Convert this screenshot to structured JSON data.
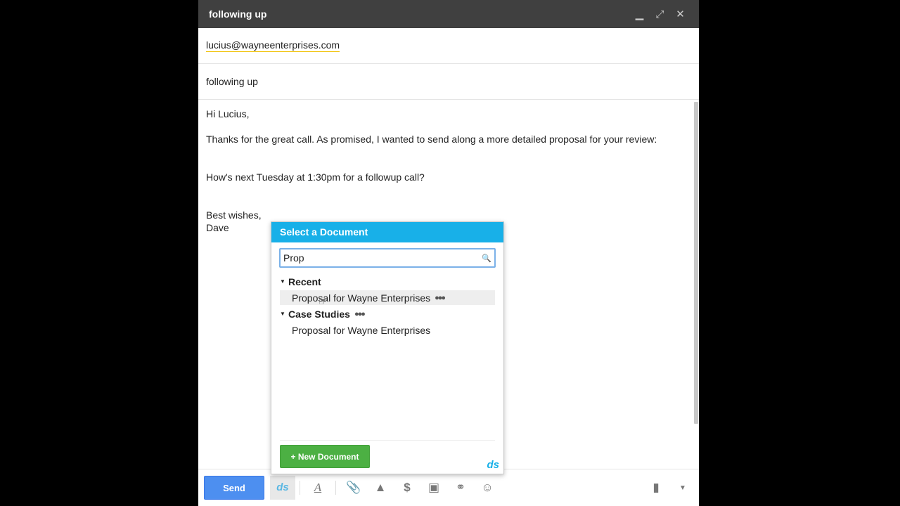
{
  "window": {
    "title": "following up",
    "minimize": "▁",
    "expand": "⤢",
    "close": "✕"
  },
  "to": "lucius@wayneenterprises.com",
  "subject": "following up",
  "body": {
    "greeting": "Hi Lucius,",
    "para1": "Thanks for the great call. As promised, I wanted to send along a more detailed proposal for your review:",
    "para2": "How's next Tuesday at 1:30pm for a followup call?",
    "signoff": "Best wishes,",
    "name": "Dave"
  },
  "popup": {
    "title": "Select a Document",
    "search_value": "Prop",
    "groups": [
      {
        "label": "Recent",
        "docs": [
          "Proposal for Wayne Enterprises"
        ]
      },
      {
        "label": "Case Studies",
        "docs": [
          "Proposal for Wayne Enterprises"
        ]
      }
    ],
    "new_button": "+ New Document",
    "logo": "ds"
  },
  "toolbar": {
    "send": "Send",
    "ds": "ds"
  },
  "colors": {
    "accent": "#18b0e8",
    "send": "#4d8ff0",
    "new_doc": "#4cb043"
  }
}
